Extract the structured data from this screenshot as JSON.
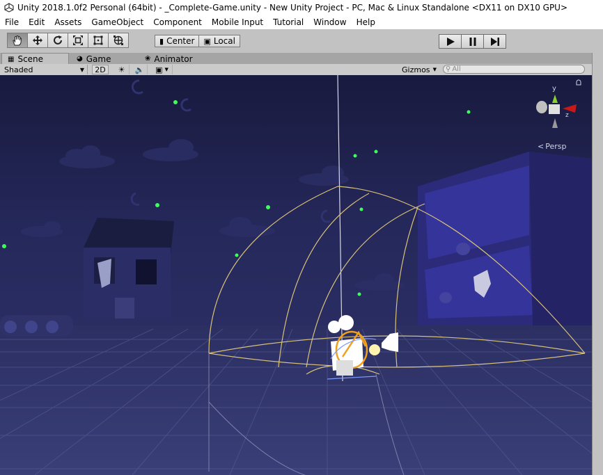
{
  "window": {
    "title": "Unity 2018.1.0f2 Personal (64bit) - _Complete-Game.unity - New Unity Project - PC, Mac & Linux Standalone <DX11 on DX10 GPU>"
  },
  "menu": {
    "items": [
      "File",
      "Edit",
      "Assets",
      "GameObject",
      "Component",
      "Mobile Input",
      "Tutorial",
      "Window",
      "Help"
    ]
  },
  "toolbar": {
    "tools": [
      "hand-tool-icon",
      "move-tool-icon",
      "rotate-tool-icon",
      "scale-tool-icon",
      "rect-tool-icon",
      "transform-tool-icon"
    ],
    "active_tool": "hand-tool-icon",
    "pivot_label": "Center",
    "space_label": "Local",
    "playback": [
      "play-icon",
      "pause-icon",
      "step-icon"
    ]
  },
  "tabs": [
    {
      "label": "Scene",
      "icon": "scene-icon",
      "active": true
    },
    {
      "label": "Game",
      "icon": "game-icon",
      "active": false
    },
    {
      "label": "Animator",
      "icon": "animator-icon",
      "active": false
    }
  ],
  "scene_toolbar": {
    "draw_mode": "Shaded",
    "mode_2d": "2D",
    "gizmos_label": "Gizmos",
    "search_placeholder": "All"
  },
  "scene_view": {
    "projection_label": "Persp",
    "axis_y": "y",
    "axis_z": "z",
    "sky_color": "#1b1d45",
    "star_color": "#3dff5a",
    "gizmo_color": "#d9c27a"
  }
}
